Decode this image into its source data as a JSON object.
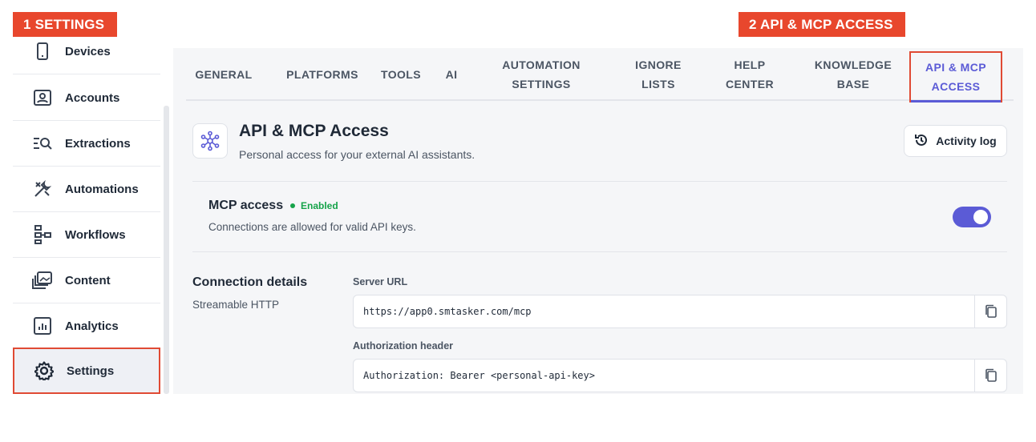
{
  "callouts": {
    "step1": "1  SETTINGS",
    "step2": "2  API & MCP ACCESS"
  },
  "sidebar": {
    "items": [
      {
        "label": "Devices",
        "icon": "phone-icon"
      },
      {
        "label": "Accounts",
        "icon": "id-card-icon"
      },
      {
        "label": "Extractions",
        "icon": "list-search-icon"
      },
      {
        "label": "Automations",
        "icon": "tools-icon"
      },
      {
        "label": "Workflows",
        "icon": "flow-icon"
      },
      {
        "label": "Content",
        "icon": "media-stack-icon"
      },
      {
        "label": "Analytics",
        "icon": "chart-icon"
      },
      {
        "label": "Settings",
        "icon": "gear-icon",
        "active": true
      }
    ]
  },
  "tabs": [
    {
      "label": "GENERAL"
    },
    {
      "label": "PLATFORMS"
    },
    {
      "label": "TOOLS"
    },
    {
      "label": "AI"
    },
    {
      "line1": "AUTOMATION",
      "line2": "SETTINGS"
    },
    {
      "line1": "IGNORE",
      "line2": "LISTS"
    },
    {
      "line1": "HELP",
      "line2": "CENTER"
    },
    {
      "line1": "KNOWLEDGE",
      "line2": "BASE"
    },
    {
      "line1": "API & MCP",
      "line2": "ACCESS",
      "active": true
    }
  ],
  "header": {
    "title": "API & MCP Access",
    "subtitle": "Personal access for your external AI assistants.",
    "activity_button": "Activity log"
  },
  "mcp": {
    "title": "MCP access",
    "status": "Enabled",
    "description": "Connections are allowed for valid API keys.",
    "enabled": true
  },
  "connection": {
    "title": "Connection details",
    "subtitle": "Streamable HTTP",
    "server_url_label": "Server URL",
    "server_url": "https://app0.smtasker.com/mcp",
    "auth_label": "Authorization header",
    "auth_value": "Authorization: Bearer <personal-api-key>"
  },
  "colors": {
    "accent": "#5b5bd6",
    "callout": "#e8472d",
    "success": "#16a34a"
  }
}
